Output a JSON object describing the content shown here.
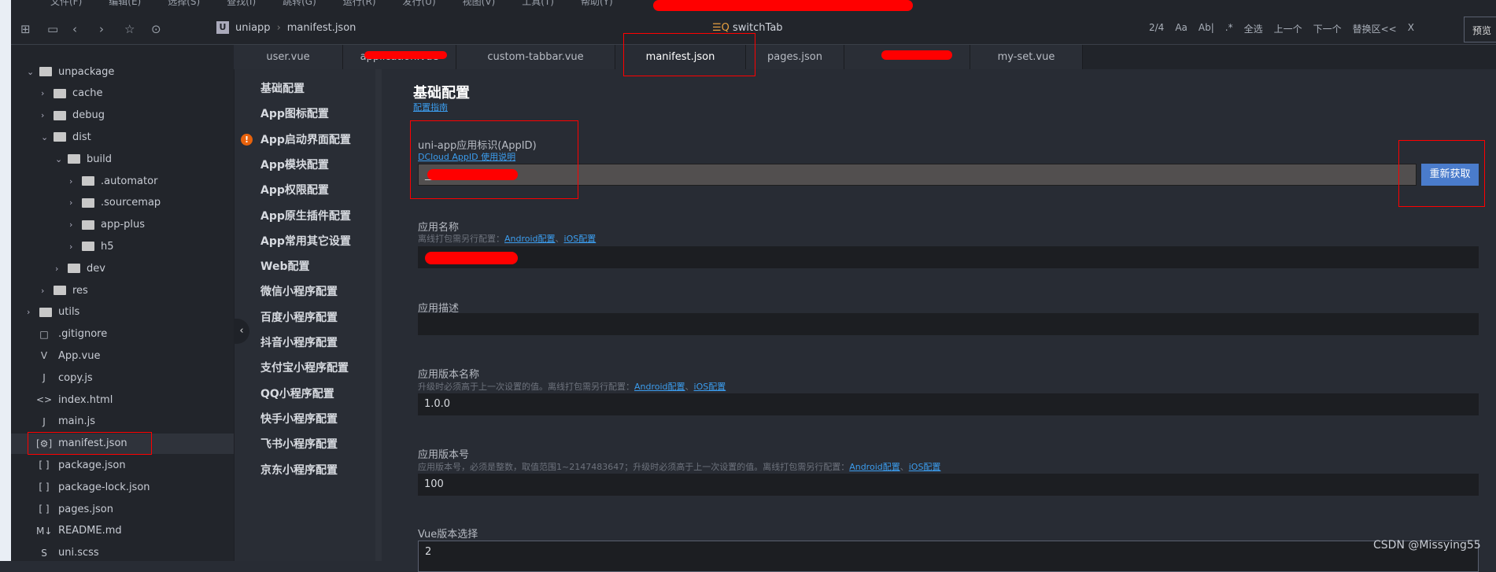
{
  "menu": [
    "文件(F)",
    "编辑(E)",
    "选择(S)",
    "查找(I)",
    "跳转(G)",
    "运行(R)",
    "发行(U)",
    "视图(V)",
    "工具(T)",
    "帮助(Y)"
  ],
  "breadcrumb": {
    "project": "uniapp",
    "file": "manifest.json"
  },
  "find": {
    "query": "switchTab",
    "count": "2/4",
    "case": "Aa",
    "word": "Ab|",
    "regex": ".*",
    "select_all": "全选",
    "prev": "上一个",
    "next": "下一个",
    "replace": "替换区<<",
    "close": "X"
  },
  "preview_label": "预览",
  "tabs": [
    "user.vue",
    "application.vue",
    "custom-tabbar.vue",
    "manifest.json",
    "pages.json",
    "",
    "my-set.vue"
  ],
  "tree": [
    {
      "name": "unpackage",
      "type": "folder-open",
      "depth": 1
    },
    {
      "name": "cache",
      "type": "folder",
      "depth": 2
    },
    {
      "name": "debug",
      "type": "folder",
      "depth": 2
    },
    {
      "name": "dist",
      "type": "folder-open",
      "depth": 2
    },
    {
      "name": "build",
      "type": "folder-open",
      "depth": 3
    },
    {
      "name": ".automator",
      "type": "folder",
      "depth": 4
    },
    {
      "name": ".sourcemap",
      "type": "folder",
      "depth": 4
    },
    {
      "name": "app-plus",
      "type": "folder",
      "depth": 4
    },
    {
      "name": "h5",
      "type": "folder",
      "depth": 4
    },
    {
      "name": "dev",
      "type": "folder",
      "depth": 3
    },
    {
      "name": "res",
      "type": "folder",
      "depth": 2
    },
    {
      "name": "utils",
      "type": "folder",
      "depth": 1
    },
    {
      "name": ".gitignore",
      "type": "file",
      "icon": "□"
    },
    {
      "name": "App.vue",
      "type": "file",
      "icon": "V"
    },
    {
      "name": "copy.js",
      "type": "file",
      "icon": "J"
    },
    {
      "name": "index.html",
      "type": "file",
      "icon": "<>"
    },
    {
      "name": "main.js",
      "type": "file",
      "icon": "J"
    },
    {
      "name": "manifest.json",
      "type": "file",
      "icon": "[⚙]",
      "selected": true
    },
    {
      "name": "package.json",
      "type": "file",
      "icon": "[ ]"
    },
    {
      "name": "package-lock.json",
      "type": "file",
      "icon": "[ ]"
    },
    {
      "name": "pages.json",
      "type": "file",
      "icon": "[ ]"
    },
    {
      "name": "README.md",
      "type": "file",
      "icon": "M↓"
    },
    {
      "name": "uni.scss",
      "type": "file",
      "icon": "S"
    }
  ],
  "nav": [
    "基础配置",
    "App图标配置",
    "App启动界面配置",
    "App模块配置",
    "App权限配置",
    "App原生插件配置",
    "App常用其它设置",
    "Web配置",
    "微信小程序配置",
    "百度小程序配置",
    "抖音小程序配置",
    "支付宝小程序配置",
    "QQ小程序配置",
    "快手小程序配置",
    "飞书小程序配置",
    "京东小程序配置"
  ],
  "content": {
    "title": "基础配置",
    "guide": "配置指南",
    "appid": {
      "label": "uni-app应用标识(AppID)",
      "link": "DCloud AppID 使用说明",
      "value": "__UNI__",
      "button": "重新获取"
    },
    "name": {
      "label": "应用名称",
      "hint": "离线打包需另行配置：",
      "android": "Android配置",
      "sep": "、",
      "ios": "iOS配置",
      "value": ""
    },
    "desc": {
      "label": "应用描述",
      "value": ""
    },
    "version_name": {
      "label": "应用版本名称",
      "hint": "升级时必须高于上一次设置的值。离线打包需另行配置：",
      "android": "Android配置",
      "sep": "、",
      "ios": "iOS配置",
      "value": "1.0.0"
    },
    "version_code": {
      "label": "应用版本号",
      "hint": "应用版本号，必须是整数，取值范围1~2147483647；升级时必须高于上一次设置的值。离线打包需另行配置：",
      "android": "Android配置",
      "sep": "、",
      "ios": "iOS配置",
      "value": "100"
    },
    "vue": {
      "label": "Vue版本选择",
      "value": "2"
    }
  },
  "watermark": "CSDN @Missying55",
  "colors": {
    "accent": "#4a7ccc",
    "link": "#3b9ced",
    "warning": "#e8620c",
    "annotation": "#ff0000"
  }
}
